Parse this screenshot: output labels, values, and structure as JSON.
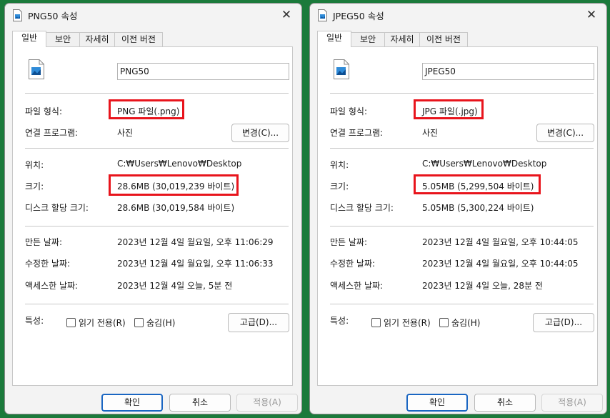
{
  "left": {
    "title": "PNG50 속성",
    "tabs": [
      "일반",
      "보안",
      "자세히",
      "이전 버전"
    ],
    "name": "PNG50",
    "file_type_label": "파일 형식:",
    "file_type": "PNG 파일(.png)",
    "opens_with_label": "연결 프로그램:",
    "opens_with": "사진",
    "change_button": "변경(C)...",
    "location_label": "위치:",
    "location": "C:₩Users₩Lenovo₩Desktop",
    "size_label": "크기:",
    "size": "28.6MB (30,019,239 바이트)",
    "disk_size_label": "디스크 할당 크기:",
    "disk_size": "28.6MB (30,019,584 바이트)",
    "created_label": "만든 날짜:",
    "created": "2023년 12월 4일 월요일, 오후 11:06:29",
    "modified_label": "수정한 날짜:",
    "modified": "2023년 12월 4일 월요일, 오후 11:06:33",
    "accessed_label": "액세스한 날짜:",
    "accessed": "2023년 12월 4일 오늘, 5분 전",
    "attributes_label": "특성:",
    "readonly_label": "읽기 전용(R)",
    "hidden_label": "숨김(H)",
    "advanced_button": "고급(D)...",
    "ok_button": "확인",
    "cancel_button": "취소",
    "apply_button": "적용(A)"
  },
  "right": {
    "title": "JPEG50 속성",
    "tabs": [
      "일반",
      "보안",
      "자세히",
      "이전 버전"
    ],
    "name": "JPEG50",
    "file_type_label": "파일 형식:",
    "file_type": "JPG 파일(.jpg)",
    "opens_with_label": "연결 프로그램:",
    "opens_with": "사진",
    "change_button": "변경(C)...",
    "location_label": "위치:",
    "location": "C:₩Users₩Lenovo₩Desktop",
    "size_label": "크기:",
    "size": "5.05MB (5,299,504 바이트)",
    "disk_size_label": "디스크 할당 크기:",
    "disk_size": "5.05MB (5,300,224 바이트)",
    "created_label": "만든 날짜:",
    "created": "2023년 12월 4일 월요일, 오후 10:44:05",
    "modified_label": "수정한 날짜:",
    "modified": "2023년 12월 4일 월요일, 오후 10:44:05",
    "accessed_label": "액세스한 날짜:",
    "accessed": "2023년 12월 4일 오늘, 28분 전",
    "attributes_label": "특성:",
    "readonly_label": "읽기 전용(R)",
    "hidden_label": "숨김(H)",
    "advanced_button": "고급(D)...",
    "ok_button": "확인",
    "cancel_button": "취소",
    "apply_button": "적용(A)"
  },
  "colors": {
    "desktop_background": "#1b7a3b",
    "highlight_box": "#e8141c",
    "ok_button_border": "#1a66c2"
  },
  "icons": {
    "title": "image-file-icon",
    "file": "image-file-icon",
    "close": "close-icon"
  }
}
